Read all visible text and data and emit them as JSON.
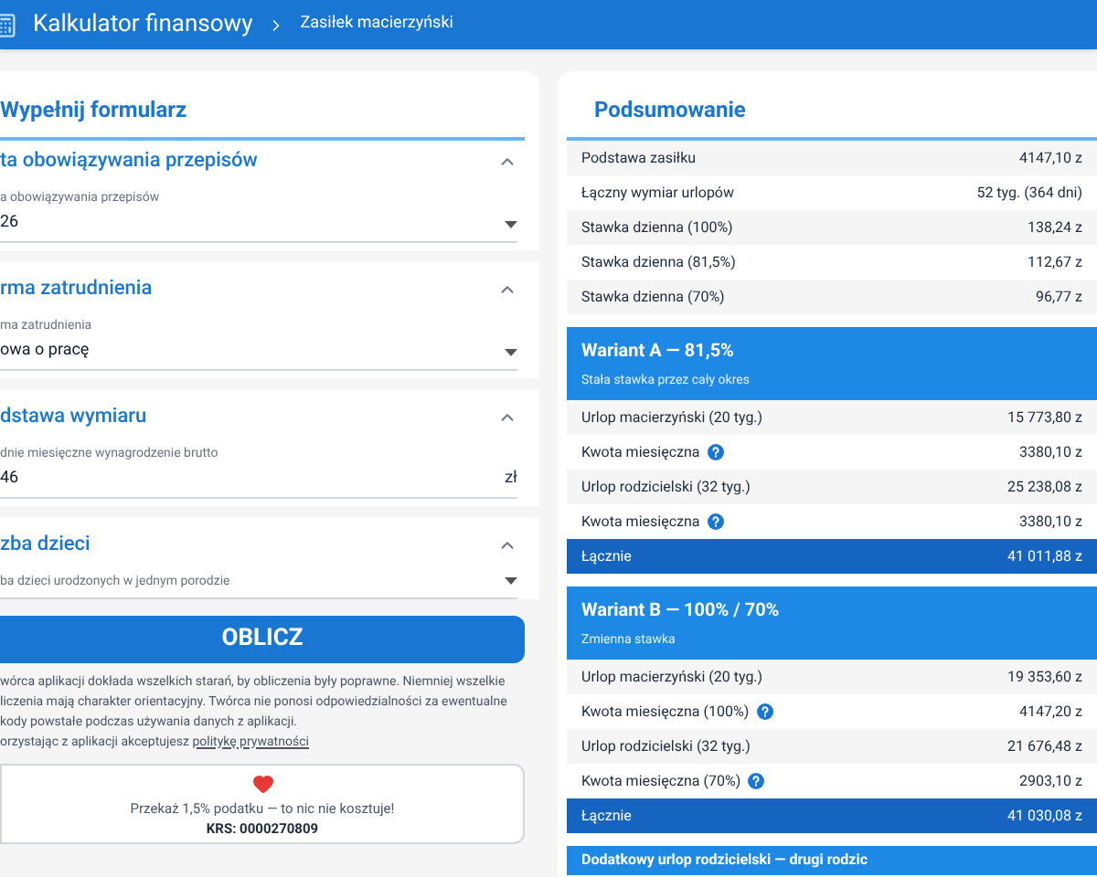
{
  "header": {
    "title": "Kalkulator finansowy",
    "breadcrumb": "Zasiłek macierzyński"
  },
  "form": {
    "title": "Wypełnij formularz",
    "sections": [
      {
        "title": "ta obowiązywania przepisów",
        "expanded": true,
        "kind": "select",
        "label": "a obowiązywania przepisów",
        "value": "26"
      },
      {
        "title": "rma zatrudnienia",
        "expanded": true,
        "kind": "select",
        "label": "ma zatrudnienia",
        "value": "owa o pracę"
      },
      {
        "title": "dstawa wymiaru",
        "expanded": true,
        "kind": "input",
        "label": "dnie miesięczne wynagrodzenie brutto",
        "value": "46",
        "suffix": "zł"
      },
      {
        "title": "zba dzieci",
        "expanded": true,
        "kind": "select",
        "label": "ba dzieci urodzonych w jednym porodzie"
      }
    ],
    "button": "OBLICZ",
    "disclaimer": "wórca aplikacji dokłada wszelkich starań, by obliczenia były poprawne. Niemniej wszelkie liczenia mają charakter orientacyjny. Twórca nie ponosi odpowiedzialności za ewentualne kody powstałe podczas używania danych z aplikacji.",
    "privacy_prefix": "orzystając z aplikacji akceptujesz",
    "privacy_link": "politykę prywatności",
    "donation": {
      "text": "Przekaż 1,5% podatku — to nic nie kosztuje!",
      "krs": "KRS: 0000270809"
    }
  },
  "summary": {
    "title": "Podsumowanie",
    "rows": [
      {
        "label": "Podstawa zasiłku",
        "value": "4147,10 z"
      },
      {
        "label": "Łączny wymiar urlopów",
        "value": "52 tyg. (364 dni)"
      },
      {
        "label": "Stawka dzienna (100%)",
        "value": "138,24 z"
      },
      {
        "label": "Stawka dzienna (81,5%)",
        "value": "112,67 z"
      },
      {
        "label": "Stawka dzienna (70%)",
        "value": "96,77 z"
      }
    ],
    "variants": [
      {
        "title": "Wariant A — 81,5%",
        "subtitle": "Stała stawka przez cały okres",
        "rows": [
          {
            "label": "Urlop macierzyński (20 tyg.)",
            "value": "15 773,80 z",
            "help": false
          },
          {
            "label": "Kwota miesięczna",
            "value": "3380,10 z",
            "help": true
          },
          {
            "label": "Urlop rodzicielski (32 tyg.)",
            "value": "25 238,08 z",
            "help": false
          },
          {
            "label": "Kwota miesięczna",
            "value": "3380,10 z",
            "help": true
          }
        ],
        "total_label": "Łącznie",
        "total_value": "41 011,88 z"
      },
      {
        "title": "Wariant B — 100% / 70%",
        "subtitle": "Zmienna stawka",
        "rows": [
          {
            "label": "Urlop macierzyński (20 tyg.)",
            "value": "19 353,60 z",
            "help": false
          },
          {
            "label": "Kwota miesięczna (100%)",
            "value": "4147,20 z",
            "help": true
          },
          {
            "label": "Urlop rodzicielski (32 tyg.)",
            "value": "21 676,48 z",
            "help": false
          },
          {
            "label": "Kwota miesięczna (70%)",
            "value": "2903,10 z",
            "help": true
          }
        ],
        "total_label": "Łącznie",
        "total_value": "41 030,08 z"
      }
    ],
    "next_title": "Dodatkowy urlop rodzicielski — drugi rodzic"
  }
}
